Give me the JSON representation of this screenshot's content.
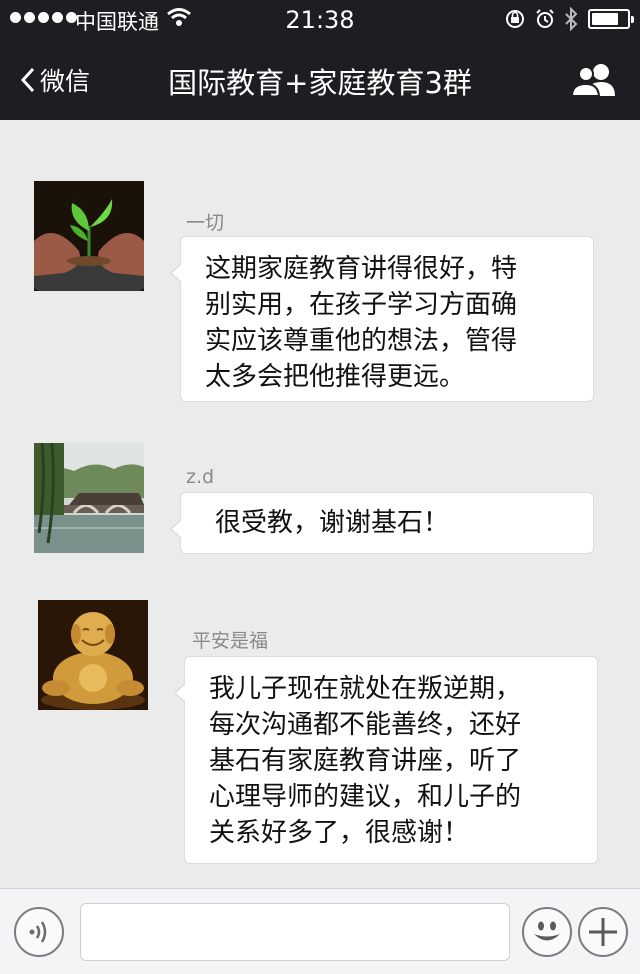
{
  "status_bar": {
    "carrier": "中国联通",
    "time": "21:38"
  },
  "nav": {
    "back_label": "微信",
    "title": "国际教育+家庭教育3群"
  },
  "messages": [
    {
      "sender": "一切",
      "avatar": "avatar-sprout-hands",
      "lines": [
        "这期家庭教育讲得很好，特",
        "别实用，在孩子学习方面确",
        "实应该尊重他的想法，管得",
        "太多会把他推得更远。"
      ]
    },
    {
      "sender": "z.d",
      "avatar": "avatar-bridge-landscape",
      "lines": [
        "很受教，谢谢基石！"
      ]
    },
    {
      "sender": "平安是福",
      "avatar": "avatar-golden-buddha",
      "lines": [
        "我儿子现在就处在叛逆期，",
        "每次沟通都不能善终，还好",
        "基石有家庭教育讲座，听了",
        "心理导师的建议，和儿子的",
        "关系好多了，很感谢！"
      ]
    }
  ],
  "input_bar": {
    "text_value": ""
  },
  "colors": {
    "header_bg": "#1e1e22",
    "chat_bg": "#ebebeb",
    "bubble_bg": "#ffffff"
  },
  "icons": [
    "voice-icon",
    "emoji-icon",
    "plus-icon",
    "back-chevron-icon",
    "group-members-icon",
    "wifi-icon",
    "lock-rotation-icon",
    "alarm-icon",
    "bluetooth-icon",
    "battery-icon"
  ]
}
